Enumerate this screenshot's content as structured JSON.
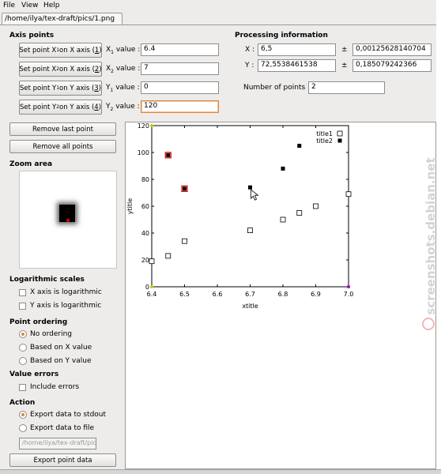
{
  "menu": [
    "File",
    "View",
    "Help"
  ],
  "tab_title": "/home/ilya/tex-draft/pics/1.png",
  "axis_points": {
    "title": "Axis points",
    "rows": [
      {
        "button_pre": "Set point X",
        "sub": "1",
        "button_mid": " on X axis (",
        "key": "1",
        "button_post": ")",
        "label_pre": "X",
        "label_sub": "1",
        "label_post": " value :",
        "value": "6.4"
      },
      {
        "button_pre": "Set point X",
        "sub": "2",
        "button_mid": " on X axis (",
        "key": "2",
        "button_post": ")",
        "label_pre": "X",
        "label_sub": "2",
        "label_post": " value :",
        "value": "7"
      },
      {
        "button_pre": "Set point Y",
        "sub": "1",
        "button_mid": " on Y axis (",
        "key": "3",
        "button_post": ")",
        "label_pre": "Y",
        "label_sub": "1",
        "label_post": " value :",
        "value": "0"
      },
      {
        "button_pre": "Set point Y",
        "sub": "2",
        "button_mid": " on Y axis (",
        "key": "4",
        "button_post": ")",
        "label_pre": "Y",
        "label_sub": "2",
        "label_post": " value :",
        "value": "120"
      }
    ]
  },
  "processing": {
    "title": "Processing information",
    "x_label": "X :",
    "x_value": "6,5",
    "x_err": "0,00125628140704",
    "y_label": "Y :",
    "y_value": "72,5538461538",
    "y_err": "0,185079242366",
    "pm": "±",
    "npoints_label": "Number of points :",
    "npoints_value": "2"
  },
  "buttons": {
    "remove_last": "Remove last point",
    "remove_all": "Remove all points",
    "export": "Export point data"
  },
  "zoom_title": "Zoom area",
  "log_scales": {
    "title": "Logarithmic scales",
    "x_log": "X axis is logarithmic",
    "y_log": "Y axis is logarithmic"
  },
  "ordering": {
    "title": "Point ordering",
    "options": [
      "No ordering",
      "Based on X value",
      "Based on Y value"
    ],
    "selected": 0
  },
  "value_errors": {
    "title": "Value errors",
    "include": "Include errors"
  },
  "action": {
    "title": "Action",
    "options": [
      "Export data to stdout",
      "Export data to file"
    ],
    "selected": 0,
    "file_placeholder": "/home/ilya/tex-draft/pics"
  },
  "watermark": "screenshots.debian.net",
  "chart_data": {
    "type": "scatter",
    "xlabel": "xtitle",
    "ylabel": "ytitle",
    "xlim": [
      6.4,
      7.0
    ],
    "ylim": [
      0,
      120
    ],
    "xticks": [
      "6.4",
      "6.5",
      "6.6",
      "6.7",
      "6.8",
      "6.9",
      "7.0"
    ],
    "yticks": [
      "0",
      "20",
      "40",
      "60",
      "80",
      "100",
      "120"
    ],
    "legend_position": "top-right",
    "series": [
      {
        "name": "title1",
        "marker": "open-square",
        "x": [
          6.4,
          6.45,
          6.5,
          6.7,
          6.8,
          6.85,
          6.9,
          7.0
        ],
        "y": [
          19,
          23,
          34,
          42,
          50,
          55,
          60,
          69
        ]
      },
      {
        "name": "title2",
        "marker": "filled-square",
        "x": [
          6.45,
          6.5,
          6.7,
          6.8,
          6.85
        ],
        "y": [
          98,
          73,
          74,
          88,
          105
        ]
      }
    ],
    "selected_points": [
      {
        "x": 6.45,
        "y": 98
      },
      {
        "x": 6.5,
        "y": 73
      }
    ]
  }
}
